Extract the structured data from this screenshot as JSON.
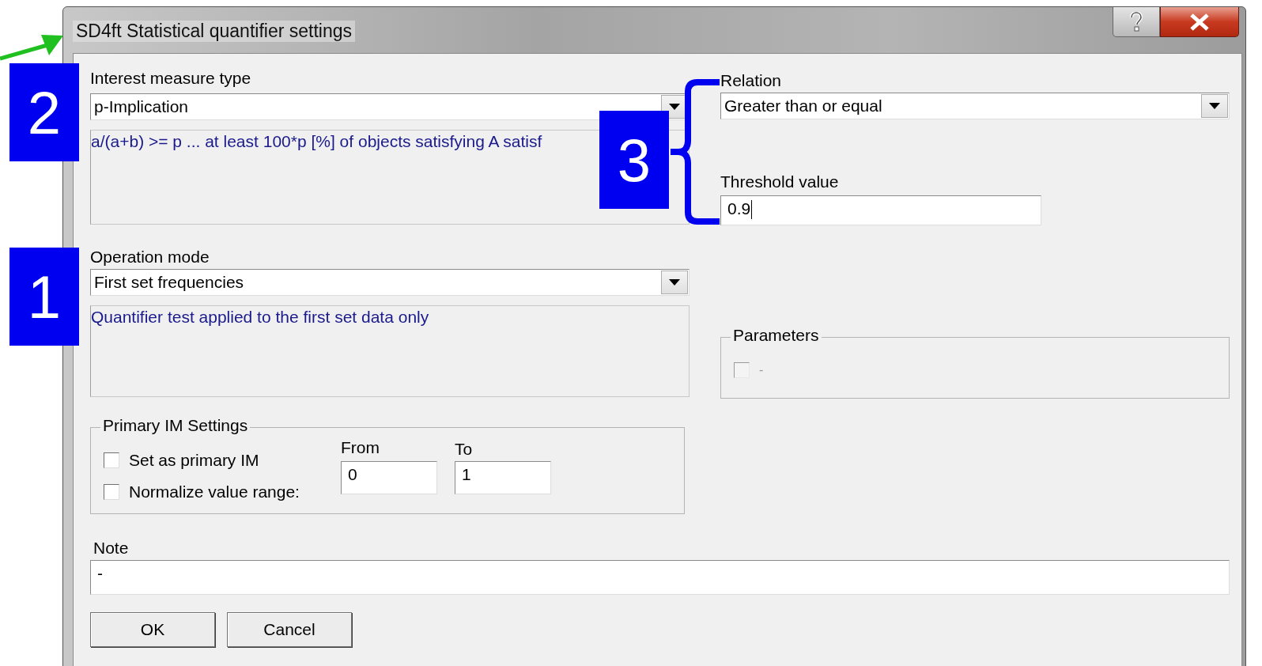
{
  "window": {
    "title": "SD4ft Statistical quantifier settings"
  },
  "interest_measure": {
    "label": "Interest measure type",
    "value": "p-Implication",
    "description": "a/(a+b) >= p ... at least 100*p [%] of objects satisfying A satisf"
  },
  "relation": {
    "label": "Relation",
    "value": "Greater than or equal"
  },
  "threshold": {
    "label": "Threshold value",
    "value": "0.9",
    "focused": true
  },
  "operation_mode": {
    "label": "Operation mode",
    "value": "First set frequencies",
    "description": "Quantifier test applied to the first set data only"
  },
  "parameters": {
    "title": "Parameters",
    "checkbox": {
      "label": "-",
      "checked": false,
      "disabled": true
    }
  },
  "primary_im": {
    "title": "Primary IM Settings",
    "checkboxes": [
      {
        "label": "Set as primary IM",
        "checked": false,
        "disabled": false
      },
      {
        "label": "Normalize value range:",
        "checked": false,
        "disabled": false
      }
    ],
    "from": {
      "label": "From",
      "value": "0"
    },
    "to": {
      "label": "To",
      "value": "1"
    }
  },
  "note": {
    "label": "Note",
    "value": "-"
  },
  "buttons": [
    "OK",
    "Cancel"
  ],
  "annotations": [
    {
      "kind": "badge",
      "label": "2"
    },
    {
      "kind": "badge",
      "label": "1"
    },
    {
      "kind": "badge",
      "label": "3"
    },
    {
      "kind": "brace"
    },
    {
      "kind": "arrow"
    }
  ]
}
